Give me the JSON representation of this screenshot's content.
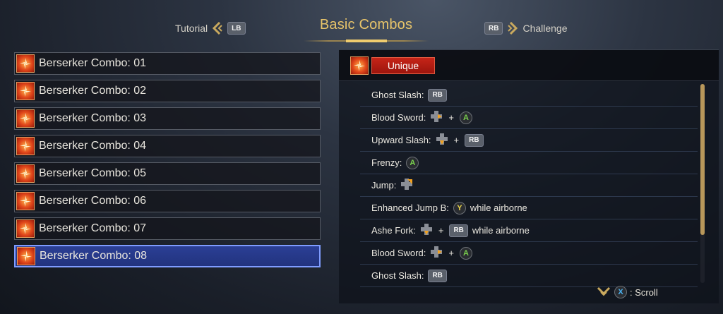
{
  "header": {
    "title": "Basic Combos",
    "left_nav": {
      "label": "Tutorial",
      "button": "LB"
    },
    "right_nav": {
      "label": "Challenge",
      "button": "RB"
    }
  },
  "combo_list": [
    {
      "label": "Berserker Combo: 01",
      "selected": false
    },
    {
      "label": "Berserker Combo: 02",
      "selected": false
    },
    {
      "label": "Berserker Combo: 03",
      "selected": false
    },
    {
      "label": "Berserker Combo: 04",
      "selected": false
    },
    {
      "label": "Berserker Combo: 05",
      "selected": false
    },
    {
      "label": "Berserker Combo: 06",
      "selected": false
    },
    {
      "label": "Berserker Combo: 07",
      "selected": false
    },
    {
      "label": "Berserker Combo: 08",
      "selected": true
    }
  ],
  "detail": {
    "tag": "Unique",
    "moves": [
      {
        "name": "Ghost Slash:",
        "inputs": [
          {
            "type": "rb",
            "text": "RB"
          }
        ],
        "suffix": ""
      },
      {
        "name": "Blood Sword:",
        "inputs": [
          {
            "type": "dpad-right"
          },
          {
            "type": "plus",
            "text": "+"
          },
          {
            "type": "a",
            "text": "A"
          }
        ],
        "suffix": ""
      },
      {
        "name": "Upward Slash:",
        "inputs": [
          {
            "type": "dpad-down"
          },
          {
            "type": "plus",
            "text": "+"
          },
          {
            "type": "rb",
            "text": "RB"
          }
        ],
        "suffix": ""
      },
      {
        "name": "Frenzy:",
        "inputs": [
          {
            "type": "a",
            "text": "A"
          }
        ],
        "suffix": ""
      },
      {
        "name": "Jump:",
        "inputs": [
          {
            "type": "dpad-upright"
          }
        ],
        "suffix": ""
      },
      {
        "name": "Enhanced Jump B:",
        "inputs": [
          {
            "type": "y",
            "text": "Y"
          }
        ],
        "suffix": "while airborne"
      },
      {
        "name": "Ashe Fork:",
        "inputs": [
          {
            "type": "dpad-down"
          },
          {
            "type": "plus",
            "text": "+"
          },
          {
            "type": "rb",
            "text": "RB"
          }
        ],
        "suffix": "while airborne"
      },
      {
        "name": "Blood Sword:",
        "inputs": [
          {
            "type": "dpad-right"
          },
          {
            "type": "plus",
            "text": "+"
          },
          {
            "type": "a",
            "text": "A"
          }
        ],
        "suffix": ""
      },
      {
        "name": "Ghost Slash:",
        "inputs": [
          {
            "type": "rb",
            "text": "RB"
          }
        ],
        "suffix": ""
      }
    ]
  },
  "footer": {
    "scroll_button": "X",
    "scroll_label": ": Scroll"
  },
  "colors": {
    "accent_gold": "#e8c46a",
    "selected_blue": "#2b3f95",
    "unique_red": "#c62418"
  }
}
